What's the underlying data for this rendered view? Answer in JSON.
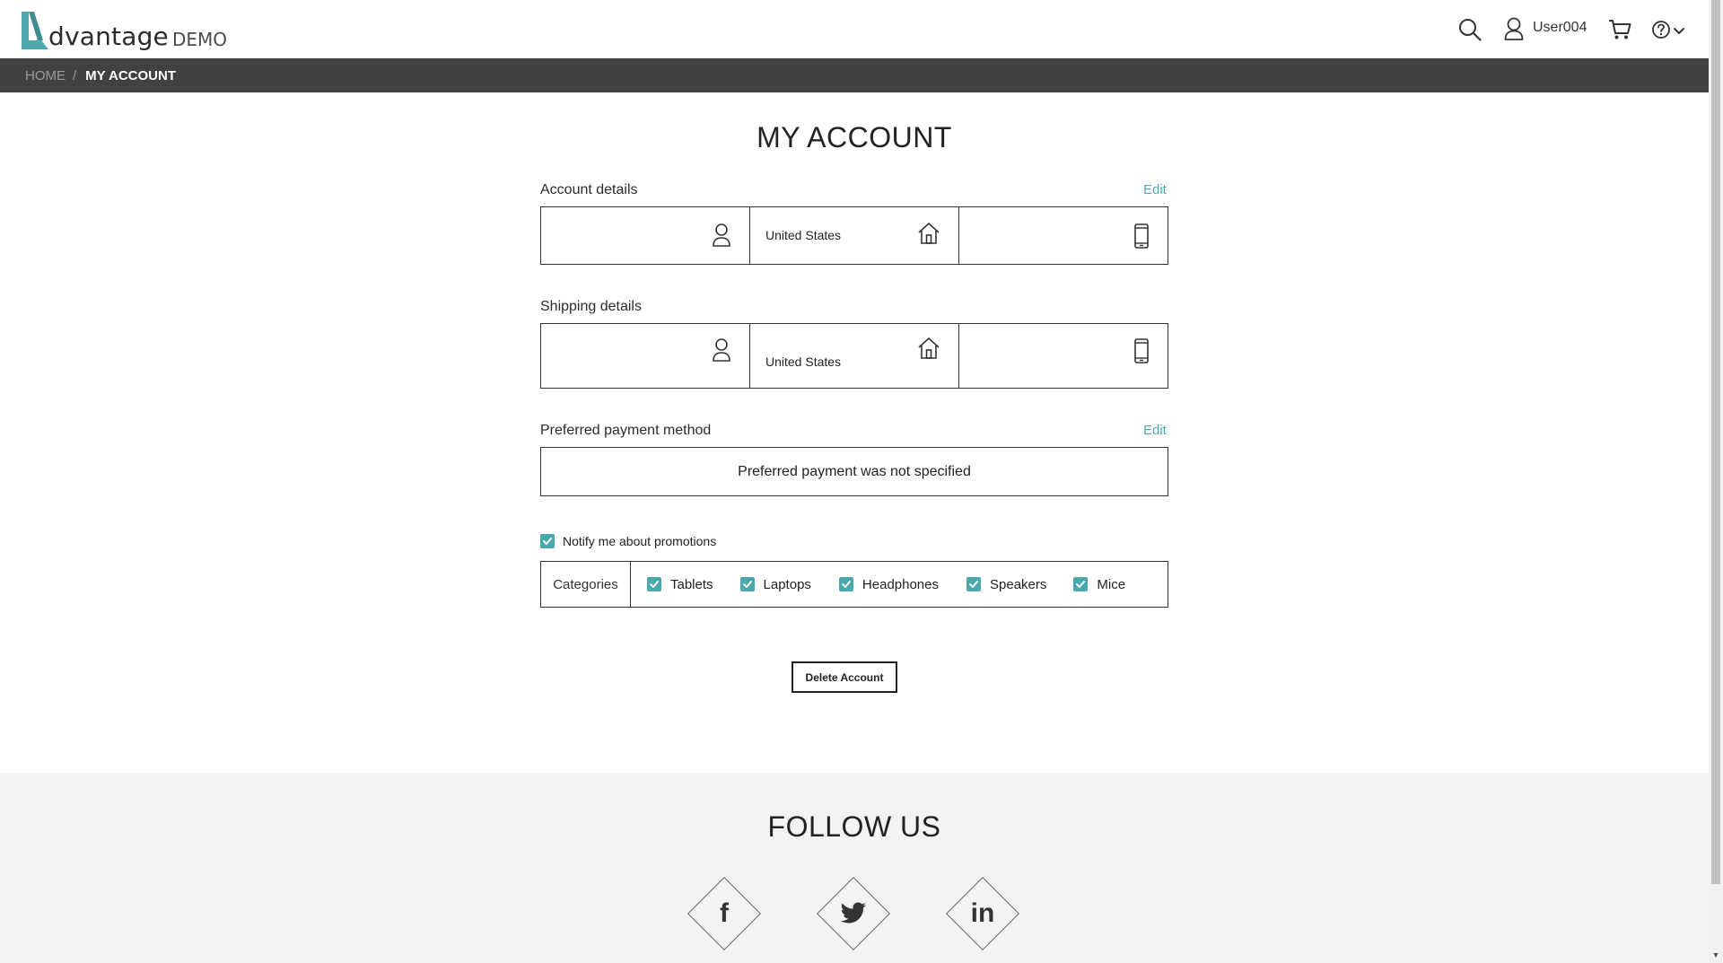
{
  "header": {
    "logo_word": "dvantage",
    "logo_demo": "DEMO",
    "user_label": "User004"
  },
  "breadcrumb": {
    "home": "HOME",
    "separator": "/",
    "current": "MY ACCOUNT"
  },
  "main": {
    "title": "MY ACCOUNT",
    "account_details": {
      "label": "Account details",
      "edit_label": "Edit",
      "name": "",
      "country": "United States",
      "phone": ""
    },
    "shipping_details": {
      "label": "Shipping details",
      "name": "",
      "country": "United States",
      "phone": ""
    },
    "payment": {
      "label": "Preferred payment method",
      "edit_label": "Edit",
      "status_text": "Preferred payment was not specified"
    },
    "promotions": {
      "notify_label": "Notify me about promotions",
      "notify_checked": true,
      "categories_label": "Categories",
      "categories": [
        {
          "label": "Tablets",
          "checked": true
        },
        {
          "label": "Laptops",
          "checked": true
        },
        {
          "label": "Headphones",
          "checked": true
        },
        {
          "label": "Speakers",
          "checked": true
        },
        {
          "label": "Mice",
          "checked": true
        }
      ]
    },
    "delete_label": "Delete Account"
  },
  "footer": {
    "follow_title": "FOLLOW US",
    "social": [
      {
        "name": "facebook",
        "glyph": "f"
      },
      {
        "name": "twitter",
        "glyph": ""
      },
      {
        "name": "linkedin",
        "glyph": "in"
      }
    ]
  },
  "colors": {
    "accent": "#49a8ab",
    "edit_link": "#4fa8b0",
    "breadcrumb_bg": "#414141",
    "footer_bg": "#f3f3f2"
  }
}
